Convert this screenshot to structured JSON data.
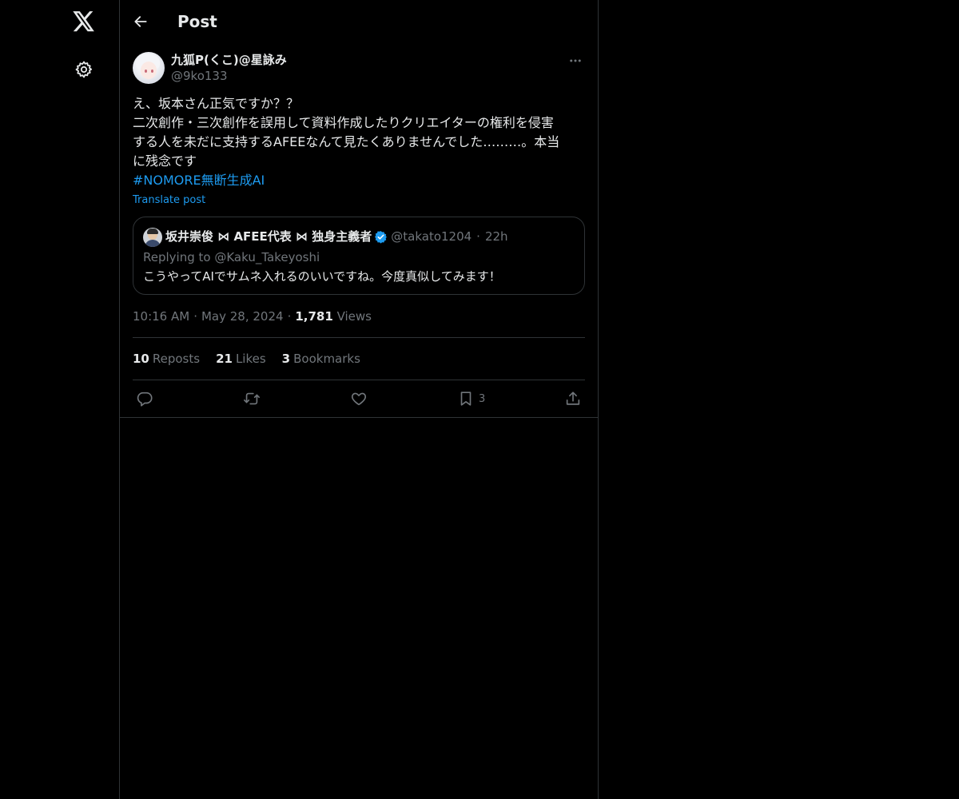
{
  "nav": {
    "logo_icon": "x-logo-icon",
    "settings_icon": "gear-icon"
  },
  "header": {
    "back_icon": "arrow-left-icon",
    "title": "Post"
  },
  "post": {
    "author": {
      "display_name": "九狐P(くこ)@星詠み",
      "handle": "@9ko133"
    },
    "more_icon": "more-horizontal-icon",
    "body_lines": [
      "え、坂本さん正気ですか？？",
      "二次創作・三次創作を誤用して資料作成したりクリエイターの権利を侵害",
      "する人を未だに支持するAFEEなんて見たくありませんでした………。本当",
      "に残念です"
    ],
    "hashtag": "#NOMORE無断生成AI",
    "translate_label": "Translate post",
    "quote": {
      "display_name": "坂井崇俊 ⋈ AFEE代表 ⋈ 独身主義者",
      "handle": "@takato1204",
      "separator": "·",
      "time": "22h",
      "replying_to": "Replying to @Kaku_Takeyoshi",
      "text": "こうやってAIでサムネ入れるのいいですね。今度真似してみます！"
    },
    "meta": {
      "time": "10:16 AM",
      "date": "May 28, 2024",
      "separator": "·",
      "views_count": "1,781",
      "views_label": "Views"
    },
    "stats": {
      "reposts_count": "10",
      "reposts_label": "Reposts",
      "likes_count": "21",
      "likes_label": "Likes",
      "bookmarks_count": "3",
      "bookmarks_label": "Bookmarks"
    },
    "actions": {
      "reply_icon": "reply-icon",
      "repost_icon": "repost-icon",
      "like_icon": "heart-icon",
      "bookmark_icon": "bookmark-icon",
      "bookmark_count": "3",
      "share_icon": "share-icon"
    }
  },
  "colors": {
    "background": "#000000",
    "text_primary": "#e7e9ea",
    "text_secondary": "#71767b",
    "accent": "#1d9bf0",
    "border": "#2f3336"
  }
}
